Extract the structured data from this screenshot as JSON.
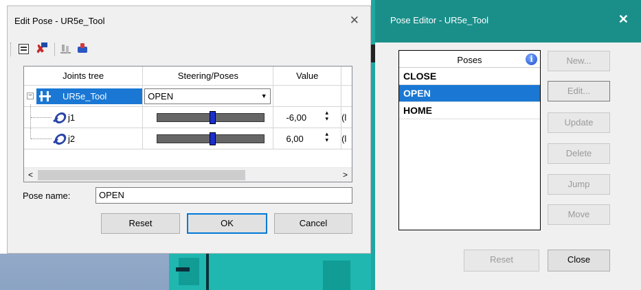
{
  "edit_pose": {
    "title": "Edit Pose - UR5e_Tool",
    "close_glyph": "✕",
    "grid": {
      "headers": [
        "Joints tree",
        "Steering/Poses",
        "Value"
      ],
      "root": {
        "name": "UR5e_Tool",
        "pose": "OPEN"
      },
      "joints": [
        {
          "name": "j1",
          "value": "-6,00",
          "unit_cut": "(l",
          "slider_position": 0.52
        },
        {
          "name": "j2",
          "value": "6,00",
          "unit_cut": "(l",
          "slider_position": 0.52
        }
      ]
    },
    "pose_name_label": "Pose name:",
    "pose_name_value": "OPEN",
    "buttons": {
      "reset": "Reset",
      "ok": "OK",
      "cancel": "Cancel"
    }
  },
  "pose_editor": {
    "title": "Pose Editor - UR5e_Tool",
    "close_glyph": "✕",
    "list_header": "Poses",
    "poses": [
      "CLOSE",
      "OPEN",
      "HOME"
    ],
    "selected_pose": "OPEN",
    "buttons": {
      "new": "New...",
      "edit": "Edit...",
      "update": "Update",
      "delete": "Delete",
      "jump": "Jump",
      "move": "Move",
      "reset": "Reset",
      "close": "Close"
    }
  },
  "colors": {
    "selection": "#1a78d4",
    "pose_titlebar": "#1a8f8a",
    "slider_thumb": "#1a2fd0"
  }
}
